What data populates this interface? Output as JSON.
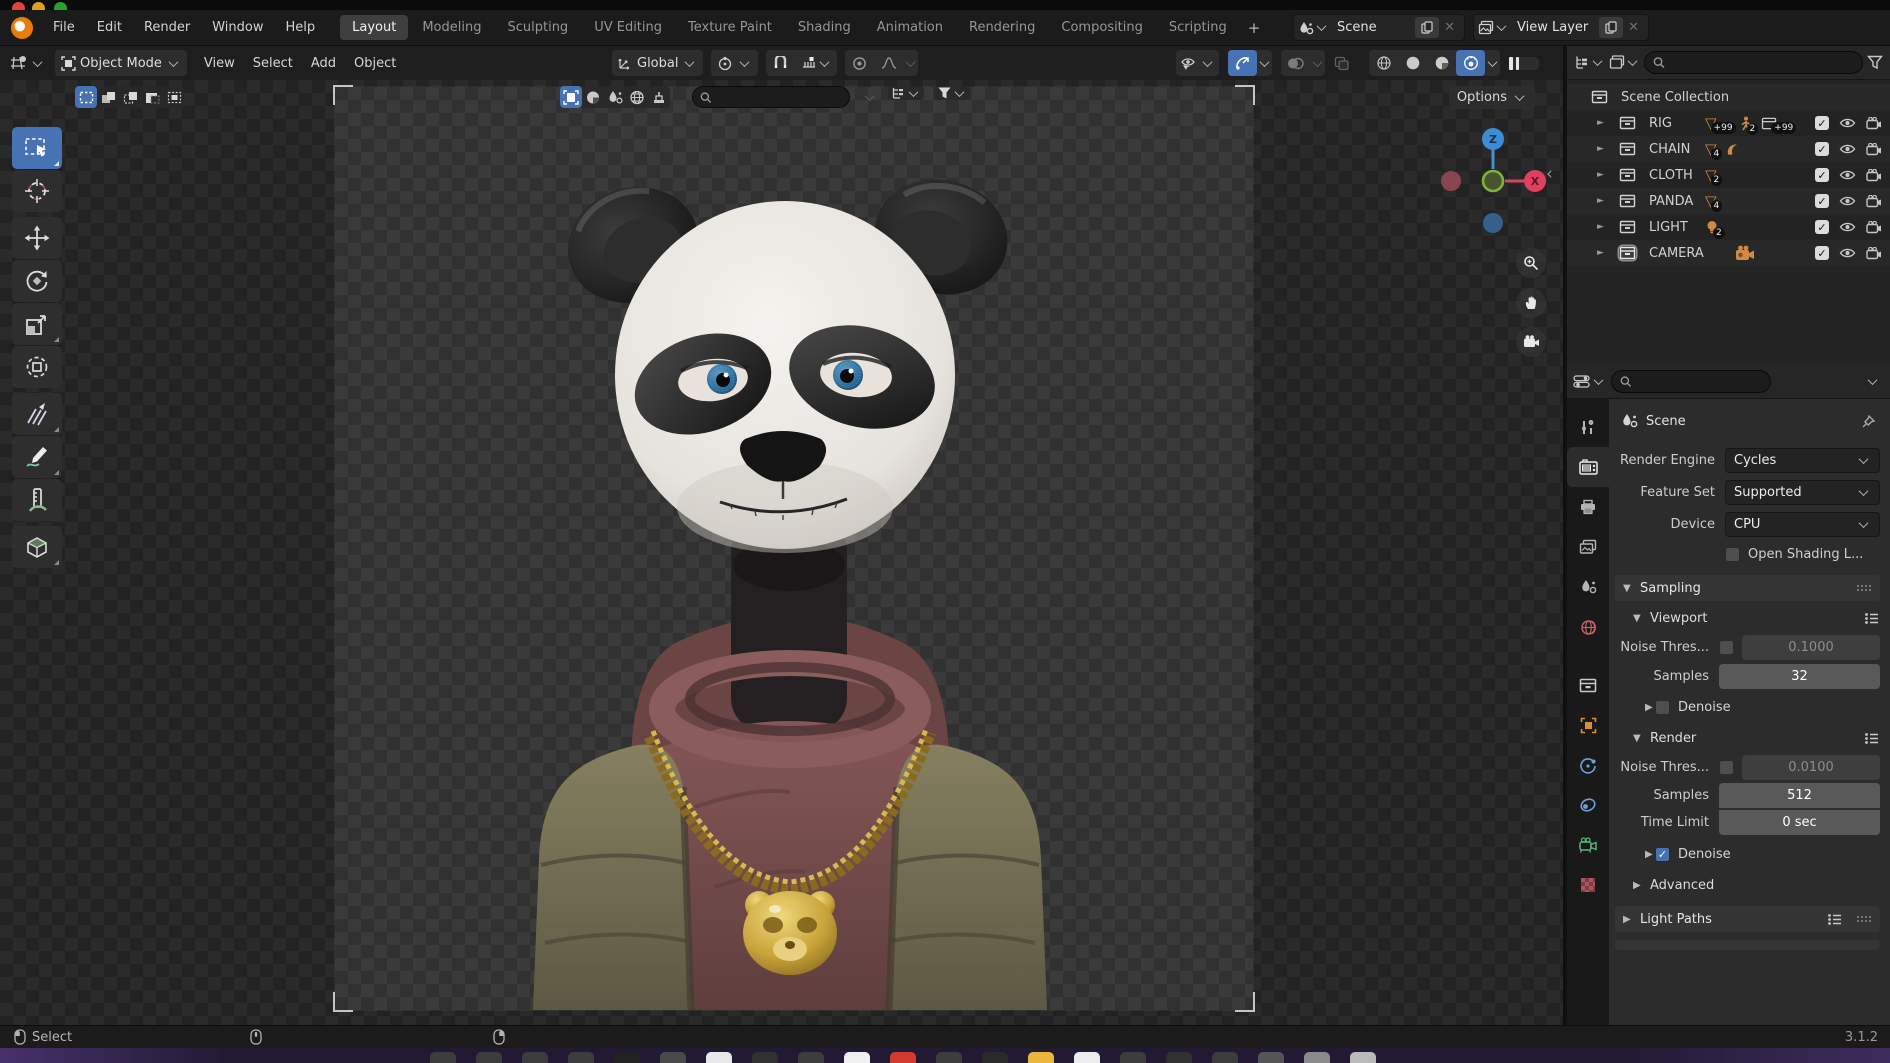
{
  "window": {
    "traffic_lights": [
      "#df453f",
      "#de9f23",
      "#27a22f"
    ]
  },
  "topbar": {
    "menus": [
      "File",
      "Edit",
      "Render",
      "Window",
      "Help"
    ],
    "tabs": [
      {
        "label": "Layout",
        "active": true
      },
      {
        "label": "Modeling"
      },
      {
        "label": "Sculpting"
      },
      {
        "label": "UV Editing"
      },
      {
        "label": "Texture Paint"
      },
      {
        "label": "Shading"
      },
      {
        "label": "Animation"
      },
      {
        "label": "Rendering"
      },
      {
        "label": "Compositing"
      },
      {
        "label": "Scripting"
      }
    ],
    "add_tab_label": "+",
    "scene": {
      "label": "Scene"
    },
    "view_layer": {
      "label": "View Layer"
    }
  },
  "viewport_header": {
    "mode": "Object Mode",
    "menus": [
      "View",
      "Select",
      "Add",
      "Object"
    ],
    "orientation": "Global",
    "options_label": "Options"
  },
  "outliner": {
    "root": "Scene Collection",
    "items": [
      {
        "label": "RIG",
        "badges": [
          {
            "icon": "mesh",
            "count": "+99"
          },
          {
            "icon": "armature",
            "count": "2"
          },
          {
            "icon": "collection",
            "count": "+99"
          }
        ]
      },
      {
        "label": "CHAIN",
        "badges": [
          {
            "icon": "mesh",
            "count": "4"
          },
          {
            "icon": "curve",
            "count": ""
          }
        ]
      },
      {
        "label": "CLOTH",
        "badges": [
          {
            "icon": "mesh",
            "count": "2"
          }
        ]
      },
      {
        "label": "PANDA",
        "badges": [
          {
            "icon": "mesh",
            "count": "4"
          }
        ]
      },
      {
        "label": "LIGHT",
        "badges": [
          {
            "icon": "light",
            "count": "2"
          }
        ]
      },
      {
        "label": "CAMERA",
        "badges": [
          {
            "icon": "camera",
            "count": ""
          }
        ],
        "selected": true
      }
    ]
  },
  "properties": {
    "breadcrumb": "Scene",
    "render_engine_label": "Render Engine",
    "render_engine": "Cycles",
    "feature_set_label": "Feature Set",
    "feature_set": "Supported",
    "device_label": "Device",
    "device": "CPU",
    "osl_label": "Open Shading L...",
    "sampling": {
      "title": "Sampling",
      "viewport": {
        "title": "Viewport",
        "noise_label": "Noise Thres...",
        "noise_value": "0.1000",
        "samples_label": "Samples",
        "samples": "32",
        "denoise_label": "Denoise"
      },
      "render": {
        "title": "Render",
        "noise_label": "Noise Thres...",
        "noise_value": "0.0100",
        "samples_label": "Samples",
        "samples": "512",
        "time_limit_label": "Time Limit",
        "time_limit": "0 sec",
        "denoise_label": "Denoise"
      },
      "advanced_label": "Advanced"
    },
    "light_paths_label": "Light Paths"
  },
  "status_bar": {
    "left": "Select",
    "version": "3.1.2"
  },
  "taskbar": {
    "icons": [
      {
        "color": "#3c3c3c"
      },
      {
        "color": "#3c3c3c"
      },
      {
        "color": "#3c3c3c"
      },
      {
        "color": "#3c3c3c"
      },
      {
        "color": "#222222"
      },
      {
        "color": "#4a4a4a"
      },
      {
        "color": "#e9e9e9"
      },
      {
        "color": "#303030"
      },
      {
        "color": "#3c3c3c"
      },
      {
        "color": "#f0f0f0"
      },
      {
        "color": "#d23b2e"
      },
      {
        "color": "#3c3c3c"
      },
      {
        "color": "#2a2a2a"
      },
      {
        "color": "#e8b73c"
      },
      {
        "color": "#ededed"
      },
      {
        "color": "#3c3c3c"
      },
      {
        "color": "#303030"
      },
      {
        "color": "#3c3c3c"
      },
      {
        "color": "#555555"
      },
      {
        "color": "#8a8a8a"
      },
      {
        "color": "#bababa"
      }
    ]
  },
  "colors": {
    "accent": "#4772b3",
    "badge_orange": "#cf8a45",
    "gold": "#c9a43a"
  }
}
